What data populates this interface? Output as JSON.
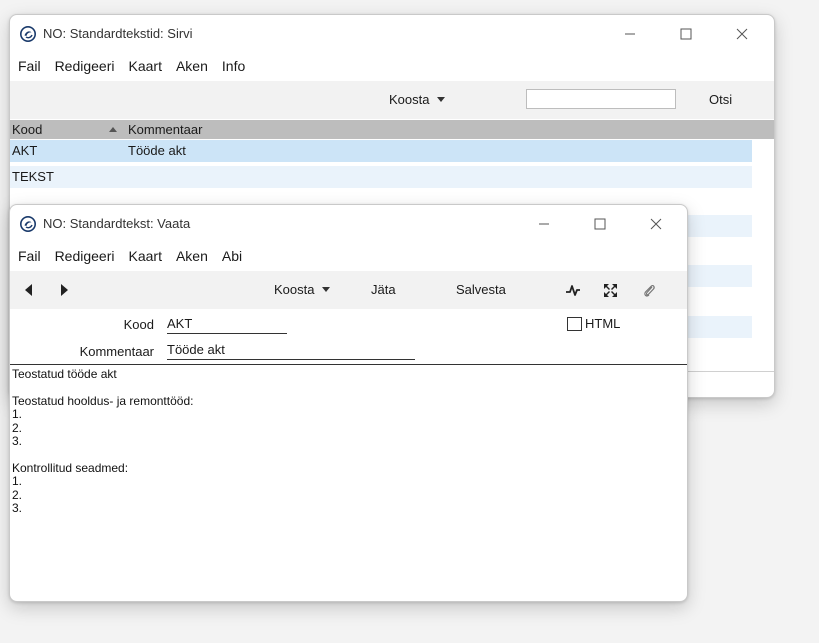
{
  "browse_window": {
    "title": "NO: Standardtekstid: Sirvi",
    "menu": [
      "Fail",
      "Redigeeri",
      "Kaart",
      "Aken",
      "Info"
    ],
    "toolbar": {
      "koosta_label": "Koosta",
      "search_value": "",
      "otsi_label": "Otsi"
    },
    "columns": {
      "kood": "Kood",
      "kommentaar": "Kommentaar"
    },
    "rows": [
      {
        "kood": "AKT",
        "kommentaar": "Tööde akt",
        "selected": true
      },
      {
        "kood": "TEKST",
        "kommentaar": "",
        "selected": false
      }
    ]
  },
  "record_window": {
    "title": "NO: Standardtekst: Vaata",
    "menu": [
      "Fail",
      "Redigeeri",
      "Kaart",
      "Aken",
      "Abi"
    ],
    "toolbar": {
      "koosta_label": "Koosta",
      "jata_label": "Jäta",
      "salvesta_label": "Salvesta"
    },
    "fields": {
      "kood_label": "Kood",
      "kood_value": "AKT",
      "kommentaar_label": "Kommentaar",
      "kommentaar_value": "Tööde akt",
      "html_label": "HTML",
      "html_checked": false
    },
    "body_text": "Teostatud tööde akt\n\nTeostatud hooldus- ja remonttööd:\n1.\n2.\n3.\n\nKontrollitud seadmed:\n1.\n2.\n3."
  },
  "colors": {
    "selected_row": "#cce4f7",
    "stripe_row": "#eaf3fb",
    "header_bar": "#bdbdbd"
  }
}
